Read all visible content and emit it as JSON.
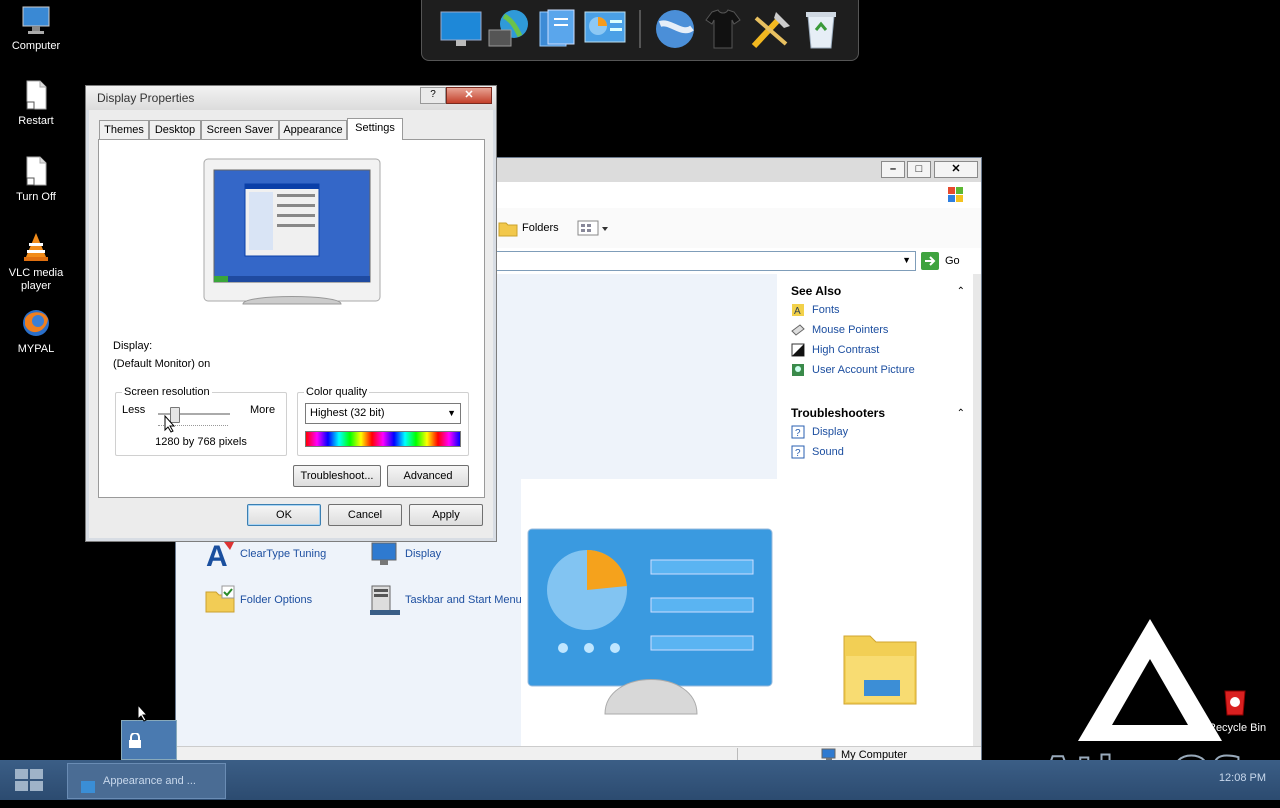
{
  "desktop": {
    "icons": [
      {
        "label": "Computer",
        "icon": "computer-icon"
      },
      {
        "label": "Restart",
        "icon": "document-shortcut-icon"
      },
      {
        "label": "Turn Off",
        "icon": "document-shortcut-icon"
      },
      {
        "label": "VLC media player",
        "icon": "vlc-cone-icon"
      },
      {
        "label": "MYPAL",
        "icon": "firefox-icon"
      }
    ],
    "recycle_bin": "Recycle Bin",
    "brand": "AtlasOS"
  },
  "explorer": {
    "toolbar": {
      "folders": "Folders"
    },
    "go": "Go",
    "see_also": {
      "title": "See Also",
      "items": [
        "Fonts",
        "Mouse Pointers",
        "High Contrast",
        "User Account Picture"
      ]
    },
    "troubleshooters": {
      "title": "Troubleshooters",
      "items": [
        "Display",
        "Sound"
      ]
    },
    "items": [
      "ClearType Tuning",
      "Display",
      "Folder Options",
      "Taskbar and Start Menu"
    ],
    "status": "My Computer"
  },
  "dialog": {
    "title": "Display Properties",
    "help": "?",
    "close": "✕",
    "tabs": [
      "Themes",
      "Desktop",
      "Screen Saver",
      "Appearance",
      "Settings"
    ],
    "display_label": "Display:",
    "display_value": "(Default Monitor) on",
    "resolution": {
      "label": "Screen resolution",
      "less": "Less",
      "more": "More",
      "value": "1280 by 768 pixels"
    },
    "color_quality": {
      "label": "Color quality",
      "selected": "Highest (32 bit)"
    },
    "buttons": {
      "troubleshoot": "Troubleshoot...",
      "advanced": "Advanced",
      "ok": "OK",
      "cancel": "Cancel",
      "apply": "Apply"
    }
  },
  "taskbar": {
    "task": "Appearance and ...",
    "clock": "12:08 PM"
  }
}
